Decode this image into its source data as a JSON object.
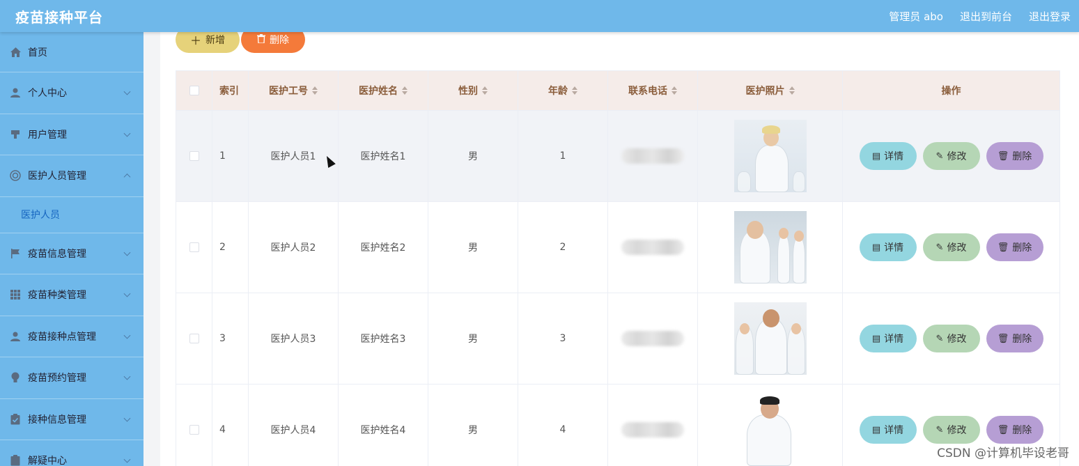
{
  "app": {
    "title": "疫苗接种平台"
  },
  "header": {
    "user_label": "管理员 abo",
    "back_to_front": "退出到前台",
    "logout": "退出登录"
  },
  "sidebar": {
    "items": [
      {
        "label": "首页",
        "icon": "home-icon"
      },
      {
        "label": "个人中心",
        "icon": "person-icon"
      },
      {
        "label": "用户管理",
        "icon": "stamp-icon"
      },
      {
        "label": "医护人员管理",
        "icon": "lifebuoy-icon",
        "expanded": true
      },
      {
        "label": "医护人员",
        "submenu": true
      },
      {
        "label": "疫苗信息管理",
        "icon": "flag-icon"
      },
      {
        "label": "疫苗种类管理",
        "icon": "grid-icon"
      },
      {
        "label": "疫苗接种点管理",
        "icon": "person-icon"
      },
      {
        "label": "疫苗预约管理",
        "icon": "bulb-icon"
      },
      {
        "label": "接种信息管理",
        "icon": "clipboard-icon"
      },
      {
        "label": "解疑中心",
        "icon": "clipboard-icon"
      }
    ]
  },
  "toolbar": {
    "add_label": "新增",
    "delete_label": "删除"
  },
  "table": {
    "headers": {
      "index": "索引",
      "staff_id": "医护工号",
      "staff_name": "医护姓名",
      "gender": "性别",
      "age": "年龄",
      "phone": "联系电话",
      "photo": "医护照片",
      "actions": "操作"
    },
    "rows": [
      {
        "index": "1",
        "staff_id": "医护人员1",
        "staff_name": "医护姓名1",
        "gender": "男",
        "age": "1"
      },
      {
        "index": "2",
        "staff_id": "医护人员2",
        "staff_name": "医护姓名2",
        "gender": "男",
        "age": "2"
      },
      {
        "index": "3",
        "staff_id": "医护人员3",
        "staff_name": "医护姓名3",
        "gender": "男",
        "age": "3"
      },
      {
        "index": "4",
        "staff_id": "医护人员4",
        "staff_name": "医护姓名4",
        "gender": "男",
        "age": "4"
      }
    ],
    "actions": {
      "detail": "详情",
      "edit": "修改",
      "delete": "删除"
    }
  },
  "watermark": "CSDN @计算机毕设老哥",
  "colors": {
    "header": "#6fb8ea",
    "sidebar": "#6fb8ea",
    "add_button": "#e6d27a",
    "delete_button": "#f47a3a",
    "detail_button": "#93d6e0",
    "edit_button": "#b5d6b5",
    "row_delete_button": "#b69ed4",
    "table_header_bg": "#f5ece9"
  }
}
